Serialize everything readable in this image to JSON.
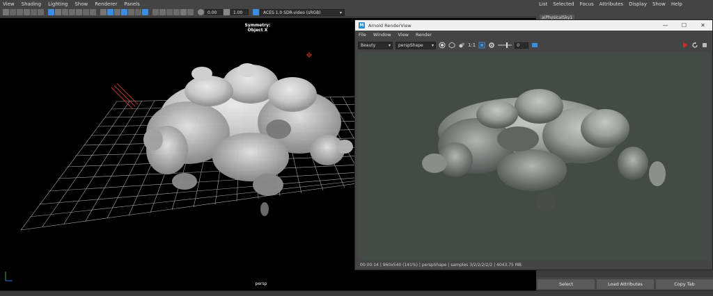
{
  "viewport": {
    "menus": [
      "View",
      "Shading",
      "Lighting",
      "Show",
      "Renderer",
      "Panels"
    ],
    "exposure": "0.00",
    "gamma": "1.00",
    "color_space": "ACES 1.0 SDR-video (sRGB)",
    "symmetry": "Symmetry: Object X",
    "camera": "persp"
  },
  "attribute_editor": {
    "menus": [
      "List",
      "Selected",
      "Focus",
      "Attributes",
      "Display",
      "Show",
      "Help"
    ],
    "tab": "aiPhysicalSky1",
    "buttons": [
      "Select",
      "Load Attributes",
      "Copy Tab"
    ]
  },
  "render_view": {
    "title": "Arnold RenderView",
    "logo": "M",
    "window_controls": [
      "—",
      "☐",
      "✕"
    ],
    "menus": [
      "File",
      "Window",
      "View",
      "Render"
    ],
    "aov": "Beauty",
    "camera": "perspShape",
    "ratio": "1:1",
    "exposure": "0",
    "status": "00:00:14 | 960x540 (141%) | perspShape | samples 3/2/2/2/2/2 | 4043.75 MB"
  },
  "colors": {
    "accent": "#3a8ee6",
    "render_bg": "#444a46",
    "play_button": "#d9262b"
  }
}
